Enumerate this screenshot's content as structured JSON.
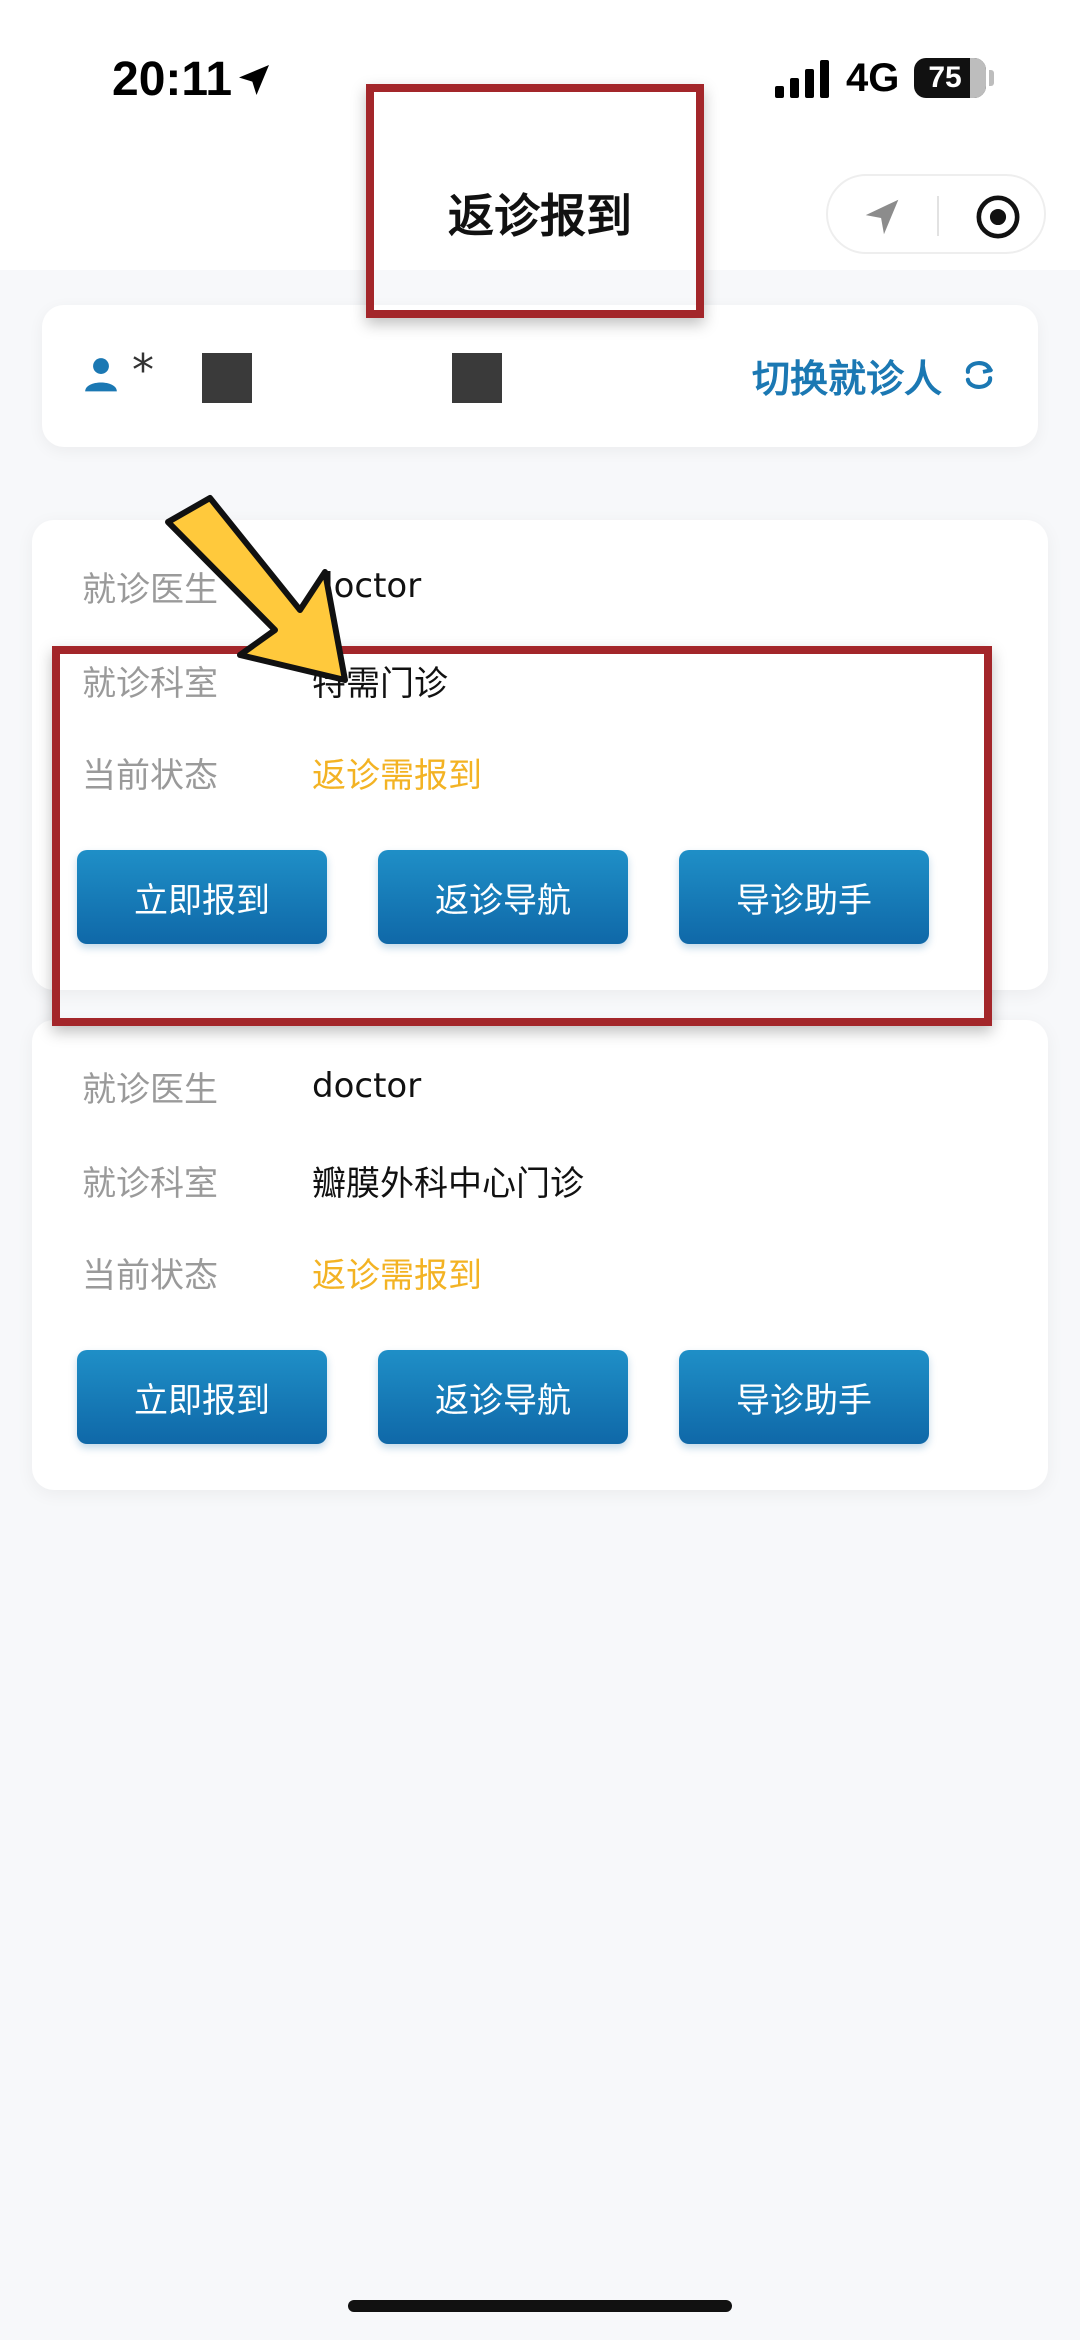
{
  "status_bar": {
    "time": "20:11",
    "network": "4G",
    "battery": "75",
    "icons": [
      "location-arrow-icon",
      "signal-bars-icon",
      "battery-icon"
    ]
  },
  "header": {
    "title": "返诊报到",
    "icons": [
      "navigation-arrow-icon",
      "target-circle-icon"
    ]
  },
  "patient": {
    "masked_name": "*",
    "switch_label": "切换就诊人",
    "icons": [
      "user-icon",
      "refresh-icon"
    ]
  },
  "visits": [
    {
      "doctor_label": "就诊医生",
      "doctor": "doctor",
      "dept_label": "就诊科室",
      "dept": "特需门诊",
      "status_label": "当前状态",
      "status": "返诊需报到",
      "buttons": {
        "checkin": "立即报到",
        "navigate": "返诊导航",
        "assistant": "导诊助手"
      }
    },
    {
      "doctor_label": "就诊医生",
      "doctor": "doctor",
      "dept_label": "就诊科室",
      "dept": "瓣膜外科中心门诊",
      "status_label": "当前状态",
      "status": "返诊需报到",
      "buttons": {
        "checkin": "立即报到",
        "navigate": "返诊导航",
        "assistant": "导诊助手"
      }
    }
  ],
  "colors": {
    "accent_blue": "#1b78b3",
    "button_top": "#1f8fc7",
    "button_bottom": "#0f68a8",
    "status_yellow": "#f3b324",
    "annotation_red": "#a3262a",
    "pointer_yellow": "#ffc93c"
  }
}
